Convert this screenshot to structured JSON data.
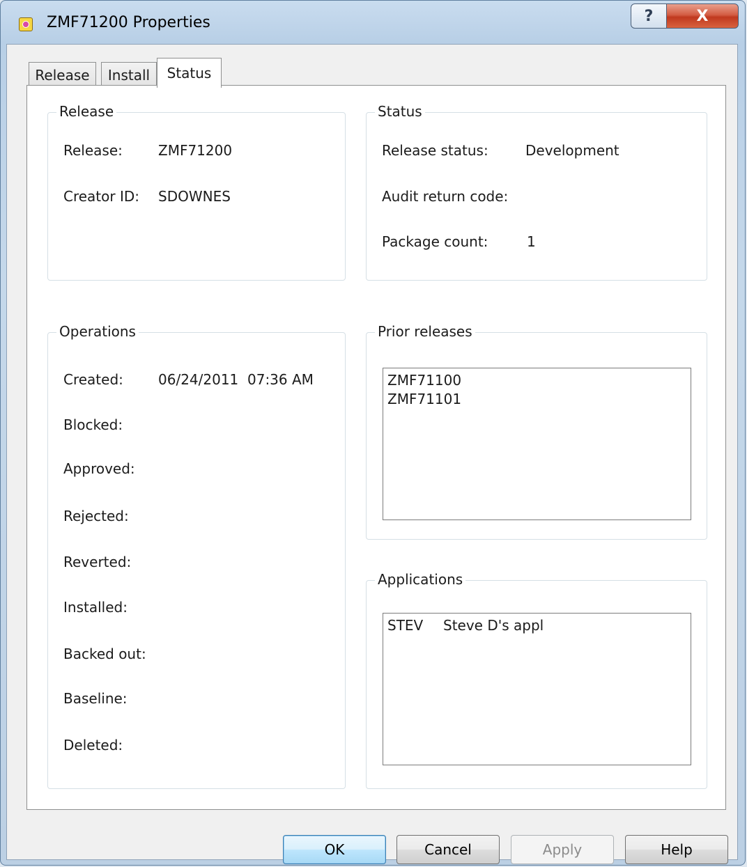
{
  "window": {
    "title": "ZMF71200 Properties",
    "help_glyph": "?",
    "close_glyph": "X"
  },
  "tabs": [
    {
      "label": "Release",
      "active": false
    },
    {
      "label": "Install",
      "active": false
    },
    {
      "label": "Status",
      "active": true
    }
  ],
  "release_group": {
    "title": "Release",
    "fields": [
      {
        "label": "Release:",
        "value": "ZMF71200"
      },
      {
        "label": "Creator ID:",
        "value": "SDOWNES"
      }
    ]
  },
  "status_group": {
    "title": "Status",
    "fields": [
      {
        "label": "Release status:",
        "value": "Development"
      },
      {
        "label": "Audit return code:",
        "value": ""
      },
      {
        "label": "Package count:",
        "value": "1"
      }
    ]
  },
  "operations_group": {
    "title": "Operations",
    "fields": [
      {
        "label": "Created:",
        "value": "06/24/2011  07:36 AM"
      },
      {
        "label": "Blocked:",
        "value": ""
      },
      {
        "label": "Approved:",
        "value": ""
      },
      {
        "label": "Rejected:",
        "value": ""
      },
      {
        "label": "Reverted:",
        "value": ""
      },
      {
        "label": "Installed:",
        "value": ""
      },
      {
        "label": "Backed out:",
        "value": ""
      },
      {
        "label": "Baseline:",
        "value": ""
      },
      {
        "label": "Deleted:",
        "value": ""
      }
    ]
  },
  "prior_releases_group": {
    "title": "Prior releases",
    "items": [
      "ZMF71100",
      "ZMF71101"
    ]
  },
  "applications_group": {
    "title": "Applications",
    "items": [
      {
        "code": "STEV",
        "name": "Steve D's appl"
      }
    ]
  },
  "buttons": {
    "ok": "OK",
    "cancel": "Cancel",
    "apply": "Apply",
    "help": "Help"
  },
  "colors": {
    "frame": "#b8cfe6",
    "panel": "#ffffff",
    "close_button": "#c0391f",
    "default_button_border": "#3c7fb1"
  }
}
